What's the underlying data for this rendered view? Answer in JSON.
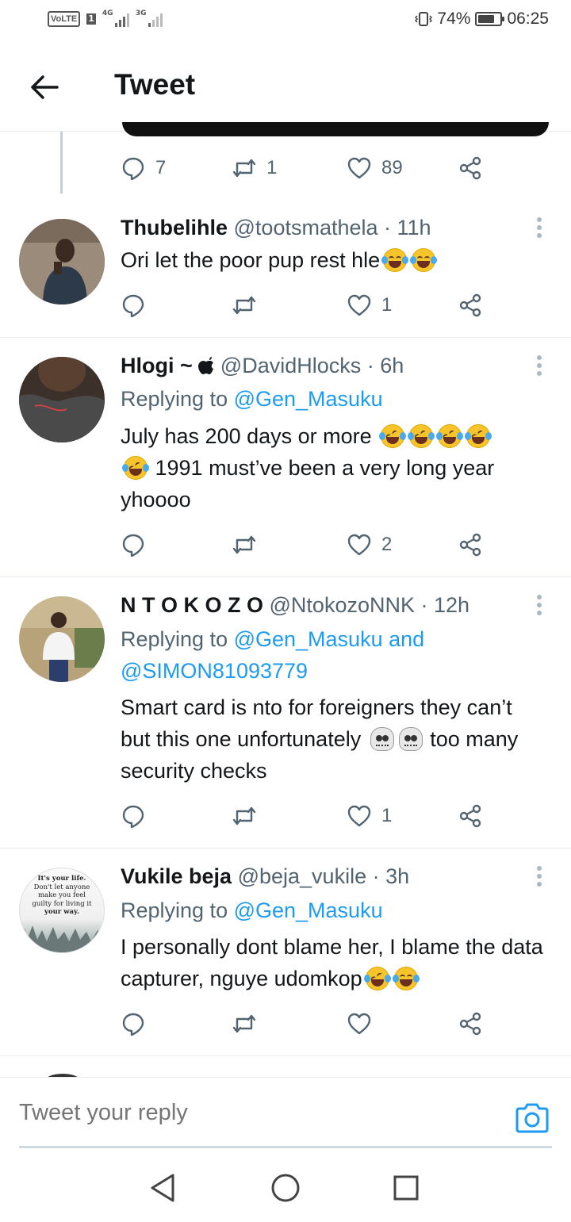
{
  "status_bar": {
    "volte": "VoLTE",
    "sim": "1",
    "net1": "4G",
    "net2": "3G",
    "battery": "74%",
    "battery_level": 0.74,
    "time": "06:25"
  },
  "header": {
    "title": "Tweet"
  },
  "parent_actions": {
    "replies": "7",
    "retweets": "1",
    "likes": "89"
  },
  "tweets": [
    {
      "name": "Thubelihle",
      "handle": "@tootsmathela",
      "time": "· 11h",
      "text": "Ori let the poor pup rest hle",
      "likes": "1"
    },
    {
      "name": "Hlogi ~ ",
      "apple": "",
      "handle": "@DavidHlocks",
      "time": "· 6h",
      "replying_prefix": "Replying to ",
      "replying_to": "@Gen_Masuku",
      "text_a": "July has 200 days or more",
      "text_b": " 1991 must’ve been a very long year yhoooo",
      "likes": "2"
    },
    {
      "name": "N T O K O Z O",
      "handle": "@NtokozoNNK",
      "time": "· 12h",
      "replying_prefix": "Replying to ",
      "replying_to": "@Gen_Masuku and @SIMON81093779",
      "text": "Smart card is nto for foreigners they can’t but this one unfortunately",
      "text_after": " too many security checks",
      "likes": "1"
    },
    {
      "name": "Vukile beja",
      "handle": "@beja_vukile",
      "time": "· 3h",
      "avatar_lines": [
        "It's your life.",
        "Don't let anyone",
        "make you feel",
        "guilty for living it",
        "your way."
      ],
      "replying_prefix": "Replying to ",
      "replying_to": "@Gen_Masuku",
      "text": "I personally dont blame her, I blame the data capturer, nguye udomkop",
      "likes": ""
    }
  ],
  "reply_bar": {
    "placeholder": "Tweet your reply"
  },
  "colors": {
    "link": "#1d9bf0",
    "muted": "#536471",
    "divider": "#e6ecf0"
  }
}
